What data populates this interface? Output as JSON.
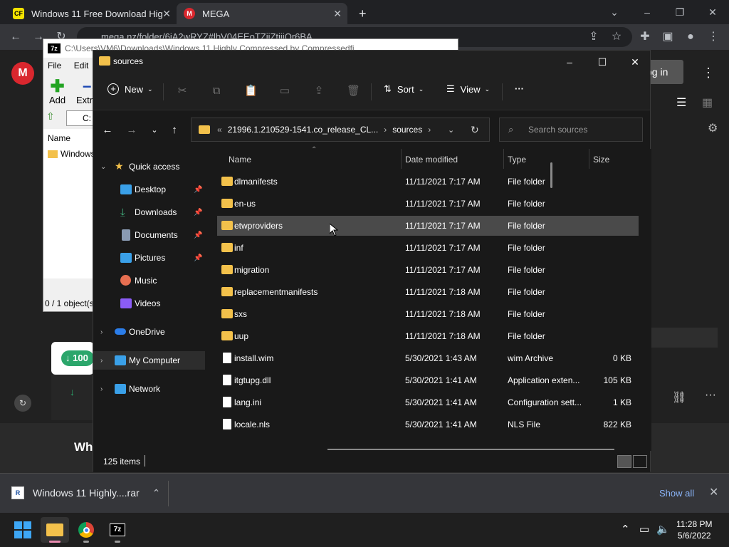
{
  "chrome": {
    "tabs": [
      {
        "title": "Windows 11 Free Download Hig",
        "favicon_text": "CF",
        "favicon_color": "#f4e300"
      },
      {
        "title": "MEGA",
        "favicon_text": "M",
        "favicon_color": "#d9272e"
      }
    ],
    "address": "mega.nz/folder/6iA2wRYZ#lbV04EEoTZiiZtiiiQr6BA"
  },
  "mega": {
    "login": "og in",
    "bottom_text": "Wh"
  },
  "sevenzip": {
    "title": "C:\\Users\\VM6\\Downloads\\Windows 11 Highly Compressed by Compressedfi...",
    "menu": [
      "File",
      "Edit"
    ],
    "add_label": "Add",
    "extract_label": "Extra",
    "path": "C:",
    "col_name": "Name",
    "row_name": "Windows",
    "status": "0 / 1 object(s",
    "progress_label": "100"
  },
  "explorer": {
    "title": "sources",
    "commands": {
      "new": "New",
      "sort": "Sort",
      "view": "View",
      "more": "···"
    },
    "address": {
      "prefix": "«",
      "segment1": "21996.1.210529-1541.co_release_CL...",
      "segment2": "sources"
    },
    "search_placeholder": "Search sources",
    "nav": [
      {
        "label": "Quick access",
        "icon": "star-icon",
        "color": "#f3c14b"
      },
      {
        "label": "Desktop",
        "icon": "desktop-icon",
        "color": "#3aa0e8"
      },
      {
        "label": "Downloads",
        "icon": "download-icon",
        "color": "#43b27f"
      },
      {
        "label": "Documents",
        "icon": "document-icon",
        "color": "#8a9bb3"
      },
      {
        "label": "Pictures",
        "icon": "pictures-icon",
        "color": "#3aa0e8"
      },
      {
        "label": "Music",
        "icon": "music-icon",
        "color": "#e76f51"
      },
      {
        "label": "Videos",
        "icon": "videos-icon",
        "color": "#8b5cf6"
      },
      {
        "label": "OneDrive",
        "icon": "cloud-icon",
        "color": "#2b7de9"
      },
      {
        "label": "My Computer",
        "icon": "computer-icon",
        "color": "#3aa0e8"
      },
      {
        "label": "Network",
        "icon": "network-icon",
        "color": "#3aa0e8"
      }
    ],
    "columns": [
      "Name",
      "Date modified",
      "Type",
      "Size"
    ],
    "rows": [
      {
        "name": "dlmanifests",
        "date": "11/11/2021 7:17 AM",
        "type": "File folder",
        "size": ""
      },
      {
        "name": "en-us",
        "date": "11/11/2021 7:17 AM",
        "type": "File folder",
        "size": ""
      },
      {
        "name": "etwproviders",
        "date": "11/11/2021 7:17 AM",
        "type": "File folder",
        "size": ""
      },
      {
        "name": "inf",
        "date": "11/11/2021 7:17 AM",
        "type": "File folder",
        "size": ""
      },
      {
        "name": "migration",
        "date": "11/11/2021 7:17 AM",
        "type": "File folder",
        "size": ""
      },
      {
        "name": "replacementmanifests",
        "date": "11/11/2021 7:18 AM",
        "type": "File folder",
        "size": ""
      },
      {
        "name": "sxs",
        "date": "11/11/2021 7:18 AM",
        "type": "File folder",
        "size": ""
      },
      {
        "name": "uup",
        "date": "11/11/2021 7:18 AM",
        "type": "File folder",
        "size": ""
      },
      {
        "name": "install.wim",
        "date": "5/30/2021 1:43 AM",
        "type": "wim Archive",
        "size": "0 KB"
      },
      {
        "name": "itgtupg.dll",
        "date": "5/30/2021 1:41 AM",
        "type": "Application exten...",
        "size": "105 KB"
      },
      {
        "name": "lang.ini",
        "date": "5/30/2021 1:41 AM",
        "type": "Configuration sett...",
        "size": "1 KB"
      },
      {
        "name": "locale.nls",
        "date": "5/30/2021 1:41 AM",
        "type": "NLS File",
        "size": "822 KB"
      }
    ],
    "status": "125 items"
  },
  "download_shelf": {
    "file": "Windows 11 Highly....rar",
    "show_all": "Show all"
  },
  "taskbar": {
    "time": "11:28 PM",
    "date": "5/6/2022",
    "apps": [
      "file-explorer",
      "chrome",
      "7-zip"
    ],
    "sevenzip_label": "7z"
  }
}
